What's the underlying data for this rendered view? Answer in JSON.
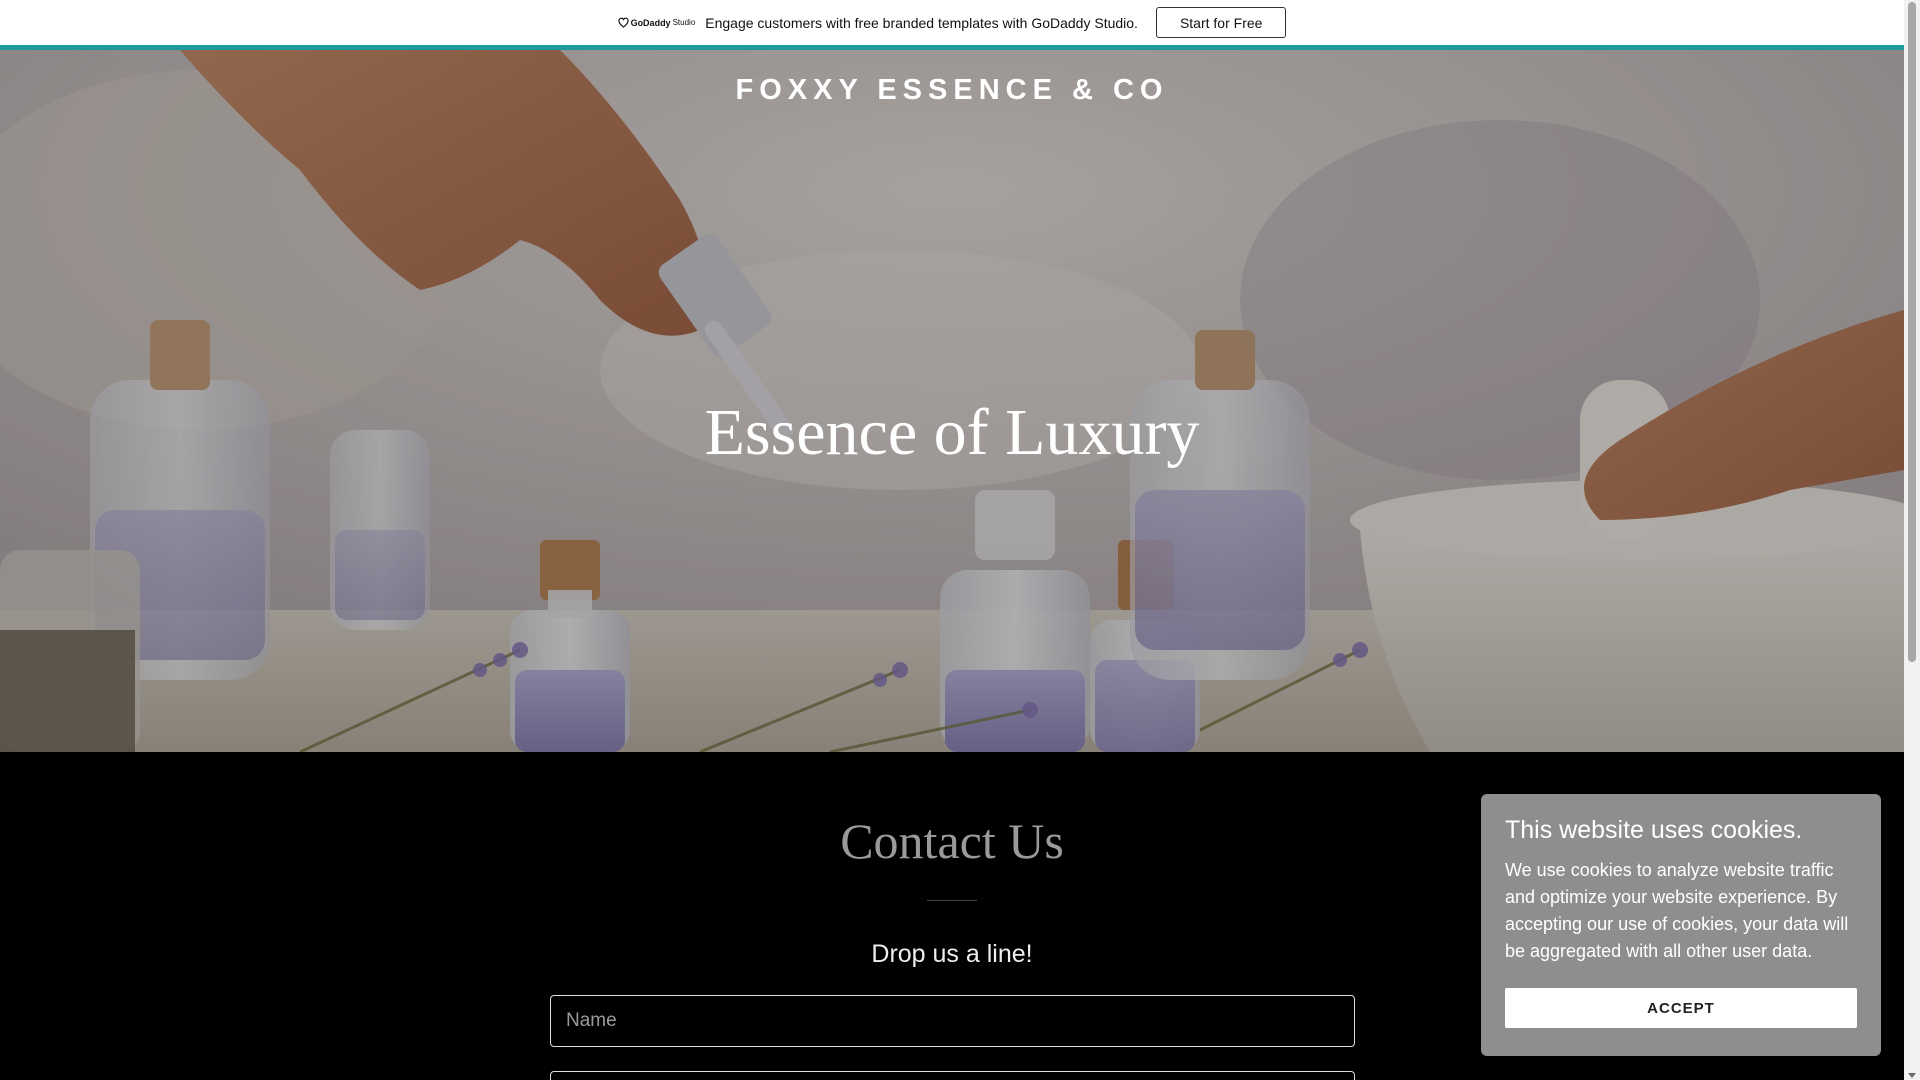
{
  "promo": {
    "logo_text": "GoDaddy",
    "logo_sub": "Studio",
    "message": "Engage customers with free branded templates with GoDaddy Studio.",
    "cta_label": "Start for Free",
    "accent_color": "#1f9a9a"
  },
  "hero": {
    "brand": "FOXXY ESSENCE & CO",
    "title": "Essence of Luxury"
  },
  "contact": {
    "title": "Contact Us",
    "subtitle": "Drop us a line!",
    "name_placeholder": "Name",
    "email_placeholder": ""
  },
  "cookie": {
    "title": "This website uses cookies.",
    "body": "We use cookies to analyze website traffic and optimize your website experience. By accepting our use of cookies, your data will be aggregated with all other user data.",
    "accept_label": "ACCEPT"
  },
  "icons": {
    "promo_logo": "godaddy-heart-icon",
    "scroll_down": "chevron-down-icon"
  }
}
